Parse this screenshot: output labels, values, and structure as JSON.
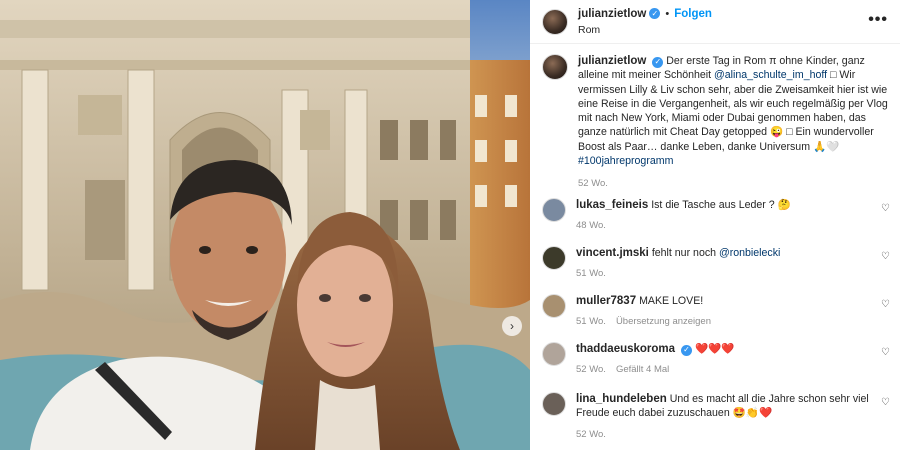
{
  "post": {
    "username": "julianzietlow",
    "follow_label": "Folgen",
    "location": "Rom",
    "more_icon": "more-horizontal-icon"
  },
  "caption": {
    "username": "julianzietlow",
    "text_1": "Der erste Tag in Rom π ohne Kinder, ganz alleine mit meiner Schönheit ",
    "mention": "@alina_schulte_im_hoff",
    "text_2": " □ Wir vermissen Lilly & Liv schon sehr, aber die Zweisamkeit hier ist wie eine Reise in die Vergangenheit, als wir euch regelmäßig per Vlog mit nach New York, Miami oder Dubai genommen haben, das ganze natürlich mit Cheat Day getopped ",
    "emoji_1": "😜",
    "text_3": " □ Ein wundervoller Boost als Paar… danke Leben, danke Universum ",
    "emoji_2": "🙏🤍",
    "hashtag": "#100jahreprogramm",
    "time": "52 Wo."
  },
  "comments": [
    {
      "username": "lukas_feineis",
      "text": "Ist die Tasche aus Leder ? ",
      "emoji": "🤔",
      "time": "48 Wo.",
      "extra": "",
      "avatar_color": "#7a8aa0"
    },
    {
      "username": "vincent.jmski",
      "text": "fehlt nur noch ",
      "mention": "@ronbielecki",
      "time": "51 Wo.",
      "extra": "",
      "avatar_color": "#3c3a2a"
    },
    {
      "username": "muller7837",
      "text": "MAKE LOVE!",
      "time": "51 Wo.",
      "extra": "Übersetzung anzeigen",
      "avatar_color": "#a89070"
    },
    {
      "username": "thaddaeuskoroma",
      "text": "",
      "hearts": "❤️❤️❤️",
      "time": "52 Wo.",
      "extra": "Gefällt 4 Mal",
      "avatar_color": "#b0a49a"
    },
    {
      "username": "lina_hundeleben",
      "text": "Und es macht all die Jahre schon sehr viel Freude euch dabei zuzuschauen ",
      "emoji": "🤩👏❤️",
      "time": "52 Wo.",
      "extra": "",
      "avatar_color": "#6a6058"
    }
  ],
  "colors": {
    "link": "#00376b",
    "follow": "#0095f6",
    "muted": "#8e8e8e",
    "verified": "#3897f0"
  }
}
